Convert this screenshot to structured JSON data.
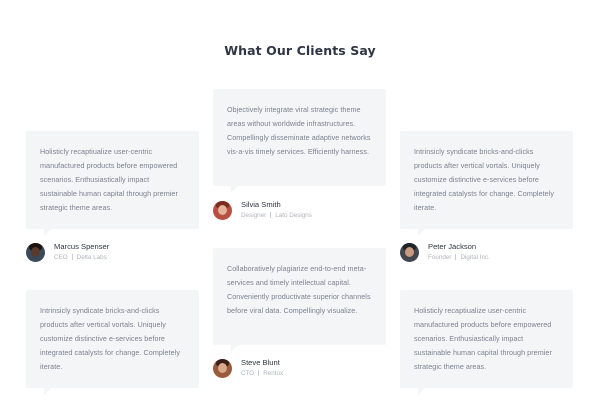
{
  "section": {
    "title": "What Our Clients Say"
  },
  "testimonials": [
    {
      "text": "Holisticly recaptiualize user-centric manufactured products before empowered scenarios. Enthusiastically impact sustainable human capital through premier strategic theme areas.",
      "name": "Marcus Spenser",
      "role": "CEO",
      "company": "Delta Labs",
      "avatar_icon": "person-avatar-icon",
      "skin": "#5a3a2a",
      "hair": "#1d140f",
      "bg": "#3b4a5a"
    },
    {
      "text": "Objectively integrate viral strategic theme areas without worldwide infrastructures. Compellingly disseminate adaptive networks vis-a-vis timely services. Efficiently harness.",
      "name": "Silvia Smith",
      "role": "Designer",
      "company": "Lato Designs",
      "avatar_icon": "person-avatar-icon",
      "skin": "#e3b49a",
      "hair": "#7a2d1f",
      "bg": "#b94e43"
    },
    {
      "text": "Intrinsicly syndicate bricks-and-clicks products after vertical vortals. Uniquely customize distinctive e-services before integrated catalysts for change. Completely iterate.",
      "name": "Peter Jackson",
      "role": "Founder",
      "company": "Digital Inc.",
      "avatar_icon": "person-avatar-icon",
      "skin": "#c99a80",
      "hair": "#1f2228",
      "bg": "#41464f"
    },
    {
      "text": "Intrinsicly syndicate bricks-and-clicks products after vertical vortals. Uniquely customize distinctive e-services before integrated catalysts for change. Completely iterate.",
      "name": "",
      "role": "",
      "company": ""
    },
    {
      "text": "Collaboratively plagiarize end-to-end meta-services and timely intellectual capital. Conveniently productivate superior channels before viral data. Compellingly visualize.",
      "name": "Steve Blunt",
      "role": "CTO",
      "company": "Rentox",
      "avatar_icon": "person-avatar-icon",
      "skin": "#d9a98c",
      "hair": "#3a2118",
      "bg": "#9a5a3c"
    },
    {
      "text": "Holisticly recaptiualize user-centric manufactured products before empowered scenarios. Enthusiastically impact sustainable human capital through premier strategic theme areas.",
      "name": "",
      "role": "",
      "company": ""
    }
  ]
}
